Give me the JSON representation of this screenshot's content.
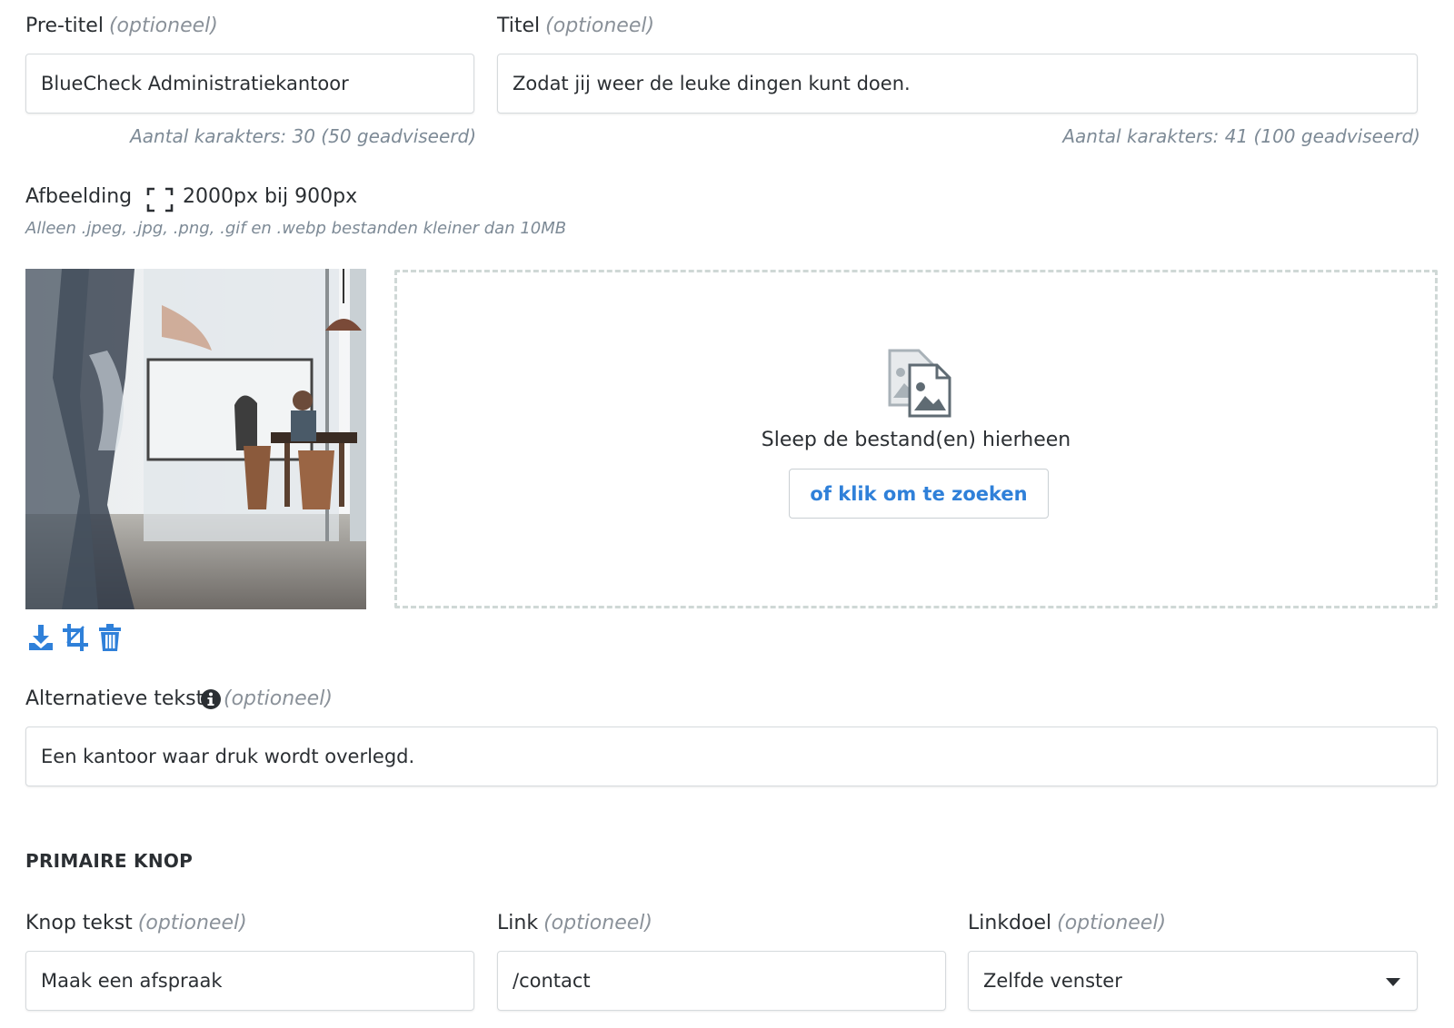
{
  "pretitle": {
    "label": "Pre-titel",
    "optional": "(optioneel)",
    "value": "BlueCheck Administratiekantoor",
    "counter": "Aantal karakters: 30 (50 geadviseerd)"
  },
  "title": {
    "label": "Titel",
    "optional": "(optioneel)",
    "value": "Zodat jij weer de leuke dingen kunt doen.",
    "counter": "Aantal karakters: 41 (100 geadviseerd)"
  },
  "image": {
    "label": "Afbeelding",
    "dimensions": "2000px bij 900px",
    "hint": "Alleen .jpeg, .jpg, .png, .gif en .webp bestanden kleiner dan 10MB",
    "dropzone_text": "Sleep de bestand(en) hierheen",
    "browse_label": "of klik om te zoeken",
    "icons": [
      "expand-icon",
      "download-icon",
      "crop-icon",
      "trash-icon",
      "file-images-icon"
    ]
  },
  "alt_text": {
    "label": "Alternatieve tekst",
    "optional": "(optioneel)",
    "value": "Een kantoor waar druk wordt overlegd."
  },
  "primary_button": {
    "section_title": "PRIMAIRE KNOP",
    "text_label": "Knop tekst",
    "text_optional": "(optioneel)",
    "text_value": "Maak een afspraak",
    "link_label": "Link",
    "link_optional": "(optioneel)",
    "link_value": "/contact",
    "target_label": "Linkdoel",
    "target_optional": "(optioneel)",
    "target_value": "Zelfde venster"
  },
  "colors": {
    "accent": "#2f80d9",
    "muted": "#7d8a96",
    "border": "#d6dadd",
    "dashed_border": "#cfd8d6"
  }
}
